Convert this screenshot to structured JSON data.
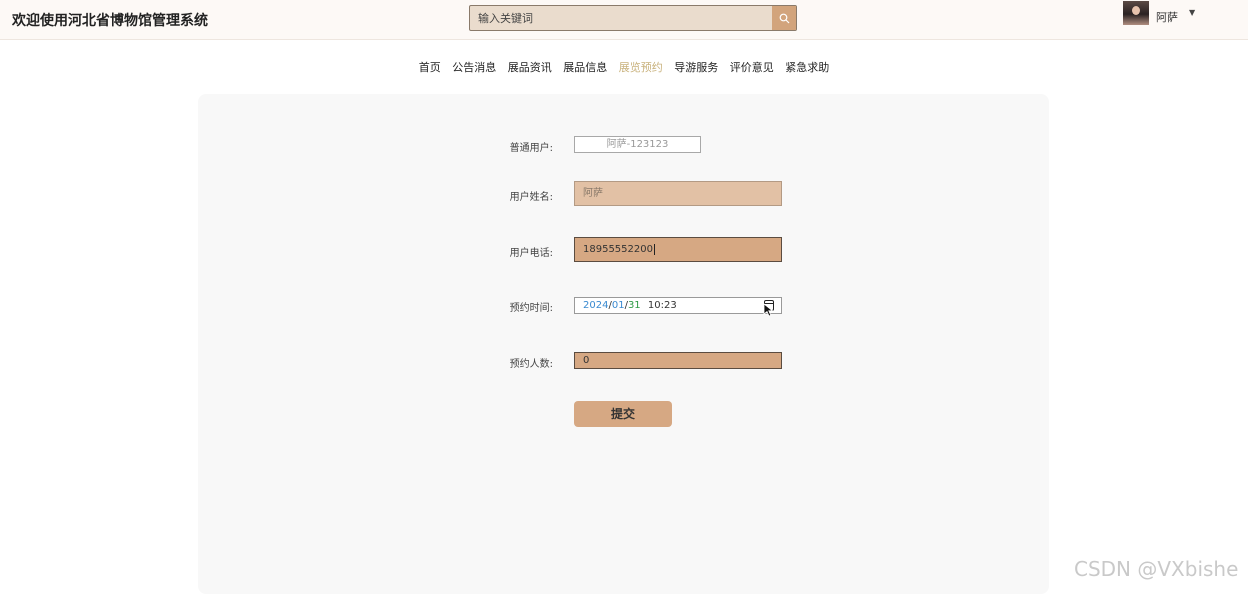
{
  "header": {
    "site_title": "欢迎使用河北省博物馆管理系统",
    "search_placeholder": "输入关键词",
    "user_name": "阿萨"
  },
  "nav": {
    "items": [
      {
        "label": "首页",
        "active": false
      },
      {
        "label": "公告消息",
        "active": false
      },
      {
        "label": "展品资讯",
        "active": false
      },
      {
        "label": "展品信息",
        "active": false
      },
      {
        "label": "展览预约",
        "active": true
      },
      {
        "label": "导游服务",
        "active": false
      },
      {
        "label": "评价意见",
        "active": false
      },
      {
        "label": "紧急求助",
        "active": false
      }
    ]
  },
  "form": {
    "username_label": "普通用户:",
    "username_value": "阿萨-123123",
    "realname_label": "用户姓名:",
    "realname_value": "阿萨",
    "phone_label": "用户电话:",
    "phone_value": "18955552200",
    "date_label": "预约时间:",
    "date_year": "2024",
    "date_month": "01",
    "date_day": "31",
    "date_time": "10:23",
    "count_label": "预约人数:",
    "count_value": "0",
    "submit_label": "提交"
  },
  "watermark": "CSDN @VXbishe",
  "colors": {
    "accent": "#d6a883",
    "nav_active": "#c9b27d",
    "search_bg": "#eadccd"
  }
}
